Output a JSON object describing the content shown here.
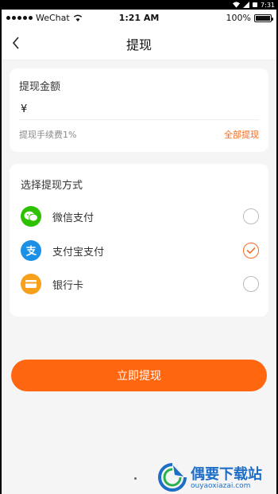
{
  "android_status": {
    "time": "7:31"
  },
  "ios_status": {
    "carrier": "WeChat",
    "time": "1:21 AM",
    "battery": "100%",
    "battery_level": 1.0
  },
  "nav": {
    "title": "提现"
  },
  "amount_card": {
    "label": "提现金额",
    "currency": "¥",
    "fee_text": "提现手续费1%",
    "withdraw_all": "全部提现"
  },
  "method_card": {
    "title": "选择提现方式",
    "methods": [
      {
        "name": "微信支付",
        "icon": "wechat-icon",
        "selected": false,
        "color": "#2dc100"
      },
      {
        "name": "支付宝支付",
        "icon": "alipay-icon",
        "selected": true,
        "color": "#1a90e6"
      },
      {
        "name": "银行卡",
        "icon": "bank-card-icon",
        "selected": false,
        "color": "#f7a01b"
      }
    ]
  },
  "submit_label": "立即提现",
  "watermark": {
    "title": "偶要下载站",
    "subtitle": "ouyaoxiazai.com"
  },
  "colors": {
    "accent": "#ff6610",
    "background": "#f5f5f5"
  }
}
